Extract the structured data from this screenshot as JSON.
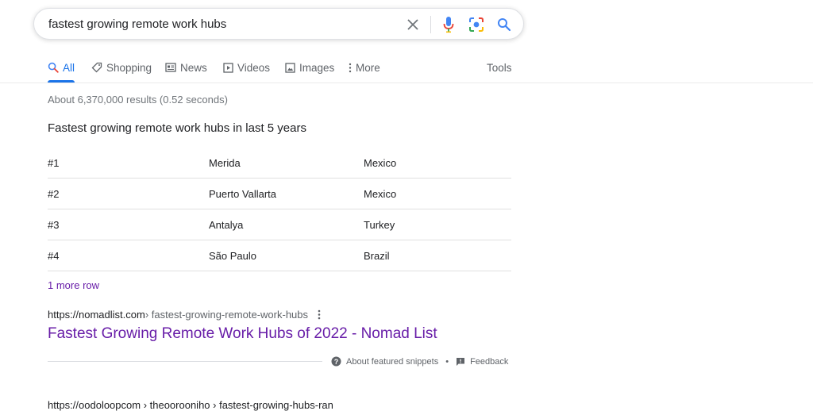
{
  "search": {
    "query": "fastest growing remote work hubs"
  },
  "tabs": {
    "all": "All",
    "shopping": "Shopping",
    "news": "News",
    "videos": "Videos",
    "images": "Images",
    "more": "More",
    "tools": "Tools"
  },
  "results": {
    "stats": "About 6,370,000 results (0.52 seconds)"
  },
  "featured_snippet": {
    "title": "Fastest growing remote work hubs in last 5 years",
    "rows": [
      [
        "#1",
        "Merida",
        "Mexico"
      ],
      [
        "#2",
        "Puerto Vallarta",
        "Mexico"
      ],
      [
        "#3",
        "Antalya",
        "Turkey"
      ],
      [
        "#4",
        "São Paulo",
        "Brazil"
      ]
    ],
    "more_rows": "1 more row",
    "cite_domain": "https://nomadlist.com",
    "cite_path": " › fastest-growing-remote-work-hubs",
    "result_title": "Fastest Growing Remote Work Hubs of 2022 - Nomad List",
    "about": "About featured snippets",
    "separator": "•",
    "feedback": "Feedback"
  },
  "next_result": {
    "cite": "https://oodoloopcom › theoorooniho › fastest-growing-hubs-ran"
  },
  "colors": {
    "accent": "#1a73e8",
    "visited_link": "#681da8",
    "muted": "#70757a"
  }
}
